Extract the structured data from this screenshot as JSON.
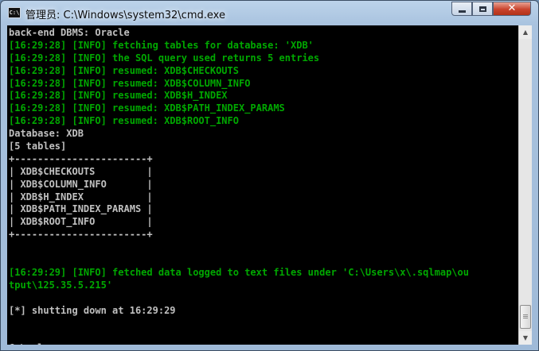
{
  "window": {
    "title": "管理员: C:\\Windows\\system32\\cmd.exe",
    "icon_label": "C:\\",
    "icon": "cmd-icon",
    "controls": {
      "minimize": "minimize-icon",
      "maximize": "maximize-icon",
      "close": "✕"
    }
  },
  "console": {
    "lines": [
      {
        "text": "back-end DBMS: Oracle",
        "color": "gray"
      },
      {
        "text": "[16:29:28] [INFO] fetching tables for database: 'XDB'",
        "color": "green"
      },
      {
        "text": "[16:29:28] [INFO] the SQL query used returns 5 entries",
        "color": "green"
      },
      {
        "text": "[16:29:28] [INFO] resumed: XDB$CHECKOUTS",
        "color": "green"
      },
      {
        "text": "[16:29:28] [INFO] resumed: XDB$COLUMN_INFO",
        "color": "green"
      },
      {
        "text": "[16:29:28] [INFO] resumed: XDB$H_INDEX",
        "color": "green"
      },
      {
        "text": "[16:29:28] [INFO] resumed: XDB$PATH_INDEX_PARAMS",
        "color": "green"
      },
      {
        "text": "[16:29:28] [INFO] resumed: XDB$ROOT_INFO",
        "color": "green"
      },
      {
        "text": "Database: XDB",
        "color": "gray"
      },
      {
        "text": "[5 tables]",
        "color": "gray"
      },
      {
        "text": "+-----------------------+",
        "color": "gray"
      },
      {
        "text": "| XDB$CHECKOUTS         |",
        "color": "gray"
      },
      {
        "text": "| XDB$COLUMN_INFO       |",
        "color": "gray"
      },
      {
        "text": "| XDB$H_INDEX           |",
        "color": "gray"
      },
      {
        "text": "| XDB$PATH_INDEX_PARAMS |",
        "color": "gray"
      },
      {
        "text": "| XDB$ROOT_INFO         |",
        "color": "gray"
      },
      {
        "text": "+-----------------------+",
        "color": "gray"
      },
      {
        "text": "",
        "color": "gray"
      },
      {
        "text": "",
        "color": "gray"
      },
      {
        "text": "[16:29:29] [INFO] fetched data logged to text files under 'C:\\Users\\x\\.sqlmap\\ou",
        "color": "green"
      },
      {
        "text": "tput\\125.35.5.215'",
        "color": "green"
      },
      {
        "text": "",
        "color": "gray"
      },
      {
        "text": "[*] shutting down at 16:29:29",
        "color": "gray"
      },
      {
        "text": "",
        "color": "gray"
      },
      {
        "text": "",
        "color": "gray"
      }
    ],
    "prompt": "C:\\sqlmap>"
  },
  "scrollbar": {
    "up_icon": "▲",
    "down_icon": "▼",
    "position": 0.93
  },
  "colors": {
    "gray": "#c0c0c0",
    "green": "#00a800",
    "background": "#000000"
  }
}
